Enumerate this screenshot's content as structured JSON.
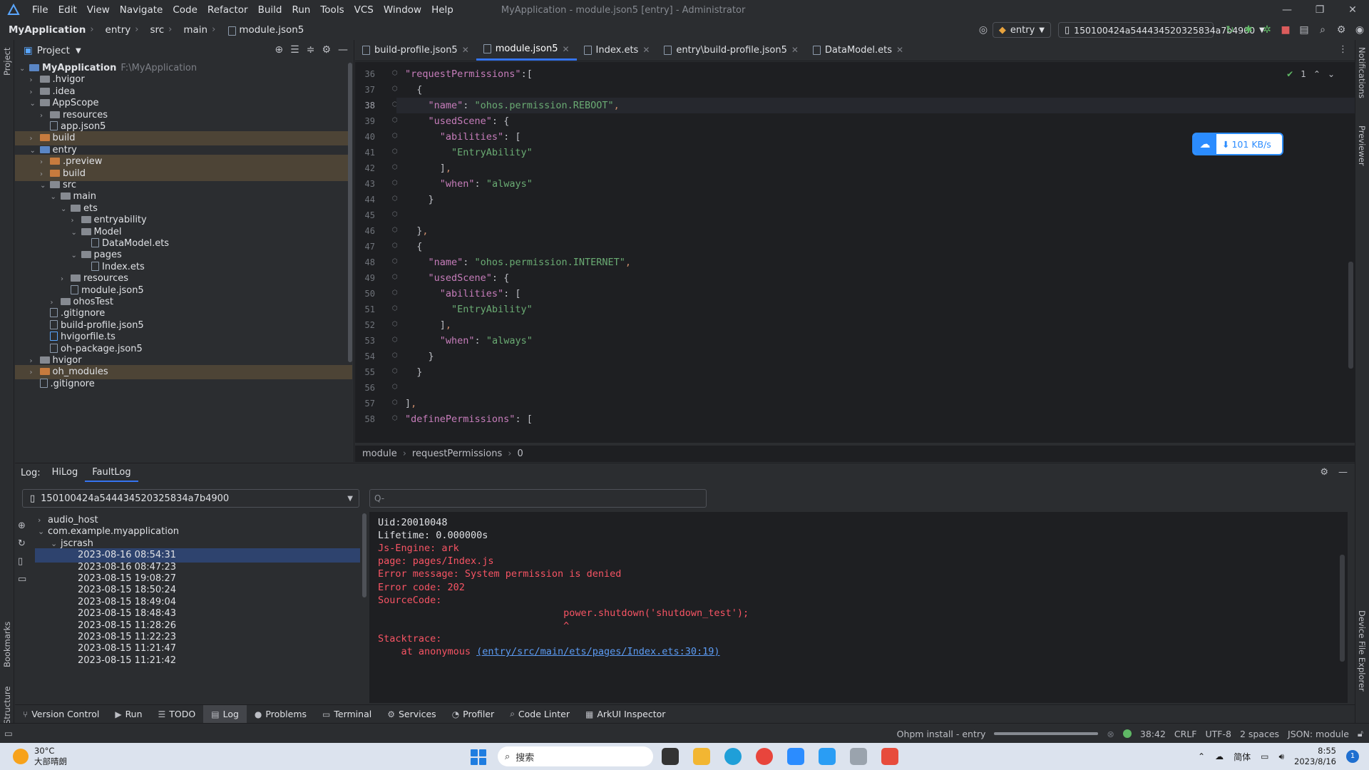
{
  "titlebar": {
    "menu": [
      "File",
      "Edit",
      "View",
      "Navigate",
      "Code",
      "Refactor",
      "Build",
      "Run",
      "Tools",
      "VCS",
      "Window",
      "Help"
    ],
    "window_title": "MyApplication - module.json5 [entry] - Administrator"
  },
  "navbar": {
    "breadcrumbs": [
      "MyApplication",
      "entry",
      "src",
      "main",
      "module.json5"
    ],
    "run_config": "entry",
    "device": "150100424a544434520325834a7b4900"
  },
  "project": {
    "header": "Project",
    "tree": [
      {
        "label": "MyApplication",
        "path": "F:\\MyApplication",
        "depth": 0,
        "type": "folder-blue",
        "arrow": "v",
        "hl": false
      },
      {
        "label": ".hvigor",
        "depth": 1,
        "type": "folder",
        "arrow": ">",
        "hl": false
      },
      {
        "label": ".idea",
        "depth": 1,
        "type": "folder",
        "arrow": ">",
        "hl": false
      },
      {
        "label": "AppScope",
        "depth": 1,
        "type": "folder",
        "arrow": "v",
        "hl": false
      },
      {
        "label": "resources",
        "depth": 2,
        "type": "folder",
        "arrow": ">",
        "hl": false
      },
      {
        "label": "app.json5",
        "depth": 2,
        "type": "file",
        "arrow": "",
        "hl": false
      },
      {
        "label": "build",
        "depth": 1,
        "type": "folder-orange",
        "arrow": ">",
        "hl": true
      },
      {
        "label": "entry",
        "depth": 1,
        "type": "folder-blue",
        "arrow": "v",
        "hl": false
      },
      {
        "label": ".preview",
        "depth": 2,
        "type": "folder-orange",
        "arrow": ">",
        "hl": true
      },
      {
        "label": "build",
        "depth": 2,
        "type": "folder-orange",
        "arrow": ">",
        "hl": true
      },
      {
        "label": "src",
        "depth": 2,
        "type": "folder",
        "arrow": "v",
        "hl": false
      },
      {
        "label": "main",
        "depth": 3,
        "type": "folder",
        "arrow": "v",
        "hl": false
      },
      {
        "label": "ets",
        "depth": 4,
        "type": "folder",
        "arrow": "v",
        "hl": false
      },
      {
        "label": "entryability",
        "depth": 5,
        "type": "folder",
        "arrow": ">",
        "hl": false
      },
      {
        "label": "Model",
        "depth": 5,
        "type": "folder",
        "arrow": "v",
        "hl": false
      },
      {
        "label": "DataModel.ets",
        "depth": 6,
        "type": "file",
        "arrow": "",
        "hl": false
      },
      {
        "label": "pages",
        "depth": 5,
        "type": "folder",
        "arrow": "v",
        "hl": false
      },
      {
        "label": "Index.ets",
        "depth": 6,
        "type": "file",
        "arrow": "",
        "hl": false
      },
      {
        "label": "resources",
        "depth": 4,
        "type": "folder",
        "arrow": ">",
        "hl": false
      },
      {
        "label": "module.json5",
        "depth": 4,
        "type": "file",
        "arrow": "",
        "hl": false
      },
      {
        "label": "ohosTest",
        "depth": 3,
        "type": "folder",
        "arrow": ">",
        "hl": false
      },
      {
        "label": ".gitignore",
        "depth": 2,
        "type": "file",
        "arrow": "",
        "hl": false
      },
      {
        "label": "build-profile.json5",
        "depth": 2,
        "type": "file",
        "arrow": "",
        "hl": false
      },
      {
        "label": "hvigorfile.ts",
        "depth": 2,
        "type": "file-ts",
        "arrow": "",
        "hl": false
      },
      {
        "label": "oh-package.json5",
        "depth": 2,
        "type": "file",
        "arrow": "",
        "hl": false
      },
      {
        "label": "hvigor",
        "depth": 1,
        "type": "folder",
        "arrow": ">",
        "hl": false
      },
      {
        "label": "oh_modules",
        "depth": 1,
        "type": "folder-orange",
        "arrow": ">",
        "hl": true
      },
      {
        "label": ".gitignore",
        "depth": 1,
        "type": "file",
        "arrow": "",
        "hl": false
      }
    ]
  },
  "editor": {
    "tabs": [
      {
        "label": "build-profile.json5",
        "active": false
      },
      {
        "label": "module.json5",
        "active": true
      },
      {
        "label": "Index.ets",
        "active": false
      },
      {
        "label": "entry\\build-profile.json5",
        "active": false
      },
      {
        "label": "DataModel.ets",
        "active": false
      }
    ],
    "first_line": 36,
    "current_line": 38,
    "lines": [
      [
        [
          "k",
          "\"requestPermissions\""
        ],
        [
          "p",
          ":["
        ]
      ],
      [
        [
          "p",
          "  {"
        ]
      ],
      [
        [
          "k",
          "    \"name\""
        ],
        [
          "p",
          ": "
        ],
        [
          "s",
          "\"ohos.permission.REBOOT\""
        ],
        [
          "o",
          ","
        ]
      ],
      [
        [
          "k",
          "    \"usedScene\""
        ],
        [
          "p",
          ": {"
        ]
      ],
      [
        [
          "k",
          "      \"abilities\""
        ],
        [
          "p",
          ": ["
        ]
      ],
      [
        [
          "s",
          "        \"EntryAbility\""
        ]
      ],
      [
        [
          "p",
          "      ]"
        ],
        [
          "o",
          ","
        ]
      ],
      [
        [
          "k",
          "      \"when\""
        ],
        [
          "p",
          ": "
        ],
        [
          "s",
          "\"always\""
        ]
      ],
      [
        [
          "p",
          "    }"
        ]
      ],
      [
        [
          "p",
          ""
        ]
      ],
      [
        [
          "p",
          "  }"
        ],
        [
          "o",
          ","
        ]
      ],
      [
        [
          "p",
          "  {"
        ]
      ],
      [
        [
          "k",
          "    \"name\""
        ],
        [
          "p",
          ": "
        ],
        [
          "s",
          "\"ohos.permission.INTERNET\""
        ],
        [
          "o",
          ","
        ]
      ],
      [
        [
          "k",
          "    \"usedScene\""
        ],
        [
          "p",
          ": {"
        ]
      ],
      [
        [
          "k",
          "      \"abilities\""
        ],
        [
          "p",
          ": ["
        ]
      ],
      [
        [
          "s",
          "        \"EntryAbility\""
        ]
      ],
      [
        [
          "p",
          "      ]"
        ],
        [
          "o",
          ","
        ]
      ],
      [
        [
          "k",
          "      \"when\""
        ],
        [
          "p",
          ": "
        ],
        [
          "s",
          "\"always\""
        ]
      ],
      [
        [
          "p",
          "    }"
        ]
      ],
      [
        [
          "p",
          "  }"
        ]
      ],
      [
        [
          "p",
          ""
        ]
      ],
      [
        [
          "p",
          "]"
        ],
        [
          "o",
          ","
        ]
      ],
      [
        [
          "k",
          "\"definePermissions\""
        ],
        [
          "p",
          ": ["
        ]
      ]
    ],
    "breadcrumb": [
      "module",
      "requestPermissions",
      "0"
    ],
    "inspection_count": "1",
    "download_speed": "101 KB/s"
  },
  "log": {
    "label": "Log:",
    "tabs": [
      {
        "label": "HiLog",
        "active": false
      },
      {
        "label": "FaultLog",
        "active": true
      }
    ],
    "device": "150100424a544434520325834a7b4900",
    "search_placeholder": "Q-",
    "crash_tree": [
      {
        "label": "audio_host",
        "depth": 0,
        "arrow": ">",
        "sel": false
      },
      {
        "label": "com.example.myapplication",
        "depth": 0,
        "arrow": "v",
        "sel": false
      },
      {
        "label": "jscrash",
        "depth": 1,
        "arrow": "v",
        "sel": false
      },
      {
        "label": "2023-08-16 08:54:31",
        "depth": 2,
        "arrow": "",
        "sel": true
      },
      {
        "label": "2023-08-16 08:47:23",
        "depth": 2,
        "arrow": "",
        "sel": false
      },
      {
        "label": "2023-08-15 19:08:27",
        "depth": 2,
        "arrow": "",
        "sel": false
      },
      {
        "label": "2023-08-15 18:50:24",
        "depth": 2,
        "arrow": "",
        "sel": false
      },
      {
        "label": "2023-08-15 18:49:04",
        "depth": 2,
        "arrow": "",
        "sel": false
      },
      {
        "label": "2023-08-15 18:48:43",
        "depth": 2,
        "arrow": "",
        "sel": false
      },
      {
        "label": "2023-08-15 11:28:26",
        "depth": 2,
        "arrow": "",
        "sel": false
      },
      {
        "label": "2023-08-15 11:22:23",
        "depth": 2,
        "arrow": "",
        "sel": false
      },
      {
        "label": "2023-08-15 11:21:47",
        "depth": 2,
        "arrow": "",
        "sel": false
      },
      {
        "label": "2023-08-15 11:21:42",
        "depth": 2,
        "arrow": "",
        "sel": false
      }
    ],
    "output": [
      {
        "text": "Uid:20010048",
        "kind": "norm"
      },
      {
        "text": "Lifetime: 0.000000s",
        "kind": "norm"
      },
      {
        "text": "Js-Engine: ark",
        "kind": "err"
      },
      {
        "text": "page: pages/Index.js",
        "kind": "err"
      },
      {
        "text": "Error message: System permission is denied",
        "kind": "err"
      },
      {
        "text": "Error code: 202",
        "kind": "err"
      },
      {
        "text": "SourceCode:",
        "kind": "err"
      },
      {
        "text": "                                power.shutdown('shutdown_test');",
        "kind": "err"
      },
      {
        "text": "                                ^",
        "kind": "err"
      },
      {
        "text": "Stacktrace:",
        "kind": "err"
      },
      {
        "text": "    at anonymous ",
        "kind": "err",
        "link": "(entry/src/main/ets/pages/Index.ets:30:19)"
      }
    ]
  },
  "tool_windows": [
    {
      "label": "Version Control",
      "icon": "⑂",
      "active": false
    },
    {
      "label": "Run",
      "icon": "▶",
      "active": false
    },
    {
      "label": "TODO",
      "icon": "☰",
      "active": false
    },
    {
      "label": "Log",
      "icon": "▤",
      "active": true
    },
    {
      "label": "Problems",
      "icon": "●",
      "active": false
    },
    {
      "label": "Terminal",
      "icon": "▭",
      "active": false
    },
    {
      "label": "Services",
      "icon": "⚙",
      "active": false
    },
    {
      "label": "Profiler",
      "icon": "◔",
      "active": false
    },
    {
      "label": "Code Linter",
      "icon": "⌕",
      "active": false
    },
    {
      "label": "ArkUI Inspector",
      "icon": "▦",
      "active": false
    }
  ],
  "side_labels": {
    "left_top": "Project",
    "left_bookmarks": "Bookmarks",
    "left_structure": "Structure",
    "right_notifications": "Notifications",
    "right_previewer": "Previewer",
    "right_device": "Device File Explorer"
  },
  "statusbar": {
    "task": "Ohpm install - entry",
    "progress": 1.0,
    "position": "38:42",
    "line_sep": "CRLF",
    "encoding": "UTF-8",
    "indent": "2 spaces",
    "file_type": "JSON: module"
  },
  "taskbar": {
    "temp": "30°C",
    "weather": "大部晴朗",
    "search": "搜索",
    "ime": "简体",
    "time": "8:55",
    "date": "2023/8/16",
    "notifications": "1"
  },
  "colors": {
    "accent": "#3574f0",
    "error": "#f75464",
    "selection": "#2e436e",
    "excluded": "#4d4436"
  }
}
